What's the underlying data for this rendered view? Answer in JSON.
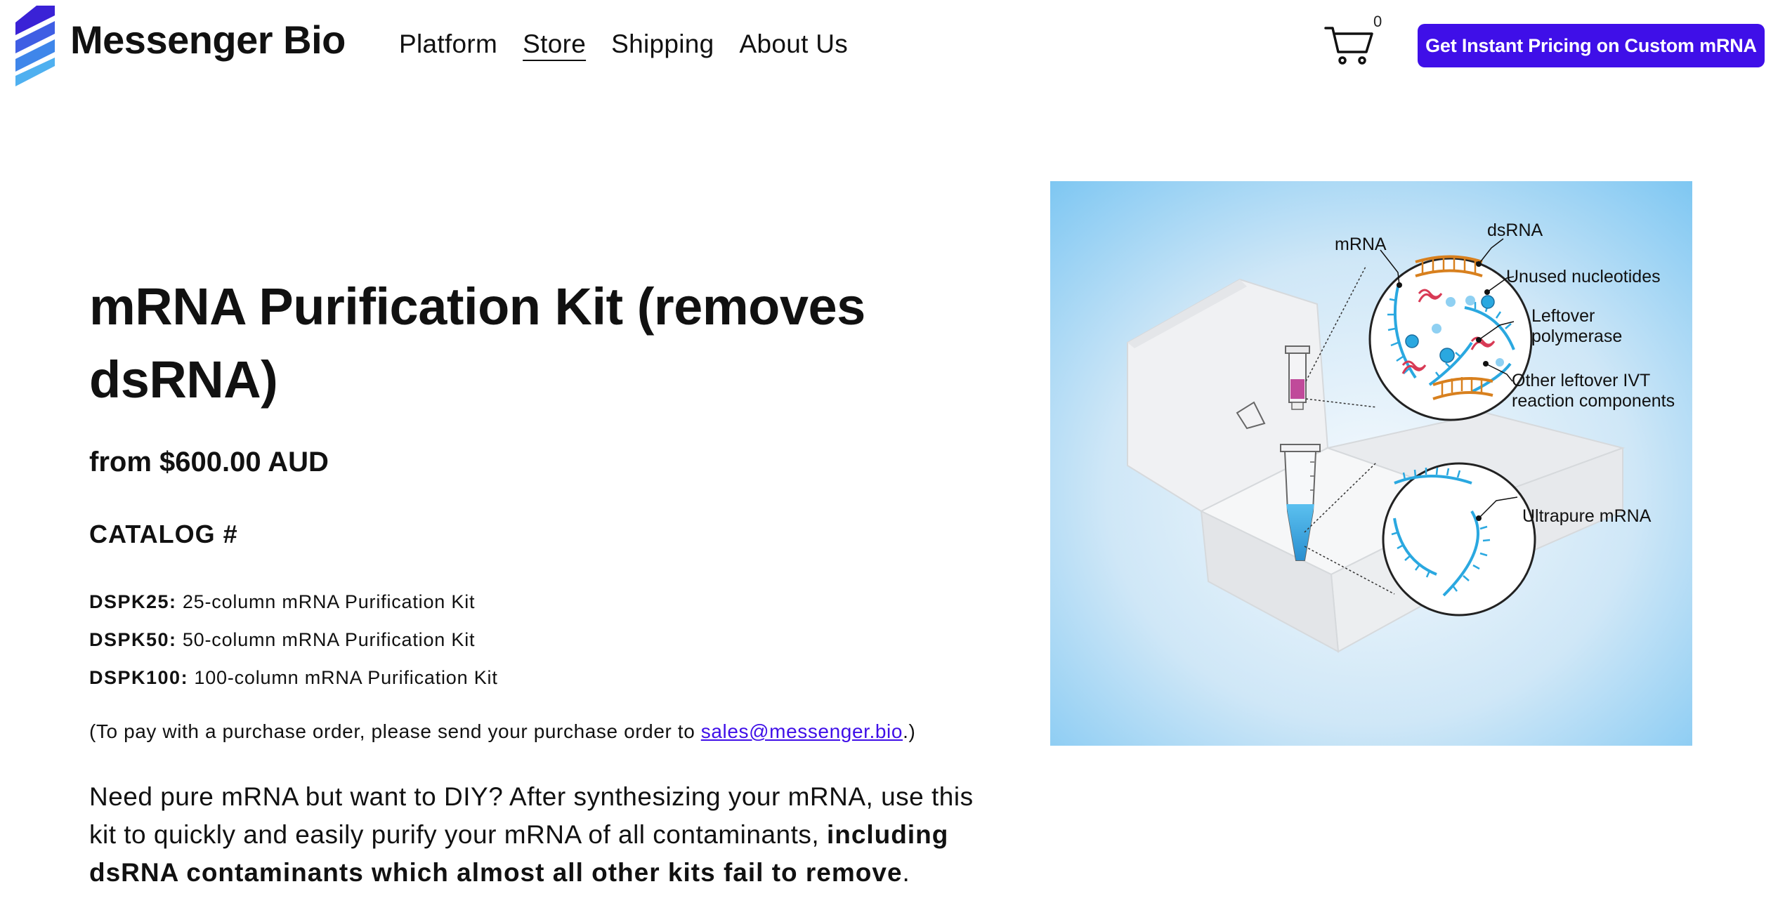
{
  "header": {
    "brand": "Messenger Bio",
    "nav": [
      {
        "label": "Platform",
        "active": false
      },
      {
        "label": "Store",
        "active": true
      },
      {
        "label": "Shipping",
        "active": false
      },
      {
        "label": "About Us",
        "active": false
      }
    ],
    "cart_count": "0",
    "cta_label": "Get Instant Pricing on Custom mRNA"
  },
  "product": {
    "title": "mRNA Purification Kit (removes dsRNA)",
    "price": "from $600.00 AUD",
    "catalog_heading": "CATALOG #",
    "catalog_items": [
      {
        "code": "DSPK25:",
        "desc": "25-column mRNA Purification Kit"
      },
      {
        "code": "DSPK50:",
        "desc": "50-column mRNA Purification Kit"
      },
      {
        "code": "DSPK100:",
        "desc": "100-column mRNA Purification Kit"
      }
    ],
    "po_note": {
      "before": "(To pay with a purchase order, please send your purchase order to ",
      "email": "sales@messenger.bio",
      "after": ".)"
    },
    "description": {
      "text": "Need pure mRNA but want to DIY? After synthesizing your mRNA, use this kit to quickly and easily purify your mRNA of all contaminants, ",
      "bold": "including dsRNA contaminants which almost all other kits fail to remove",
      "end": "."
    }
  },
  "image": {
    "labels": {
      "mrna": "mRNA",
      "dsrna": "dsRNA",
      "unused": "Unused nucleotides",
      "leftover_1": "Leftover",
      "leftover_2": "polymerase",
      "other_1": "Other leftover IVT",
      "other_2": "reaction components",
      "ultrapure": "Ultrapure mRNA"
    }
  },
  "colors": {
    "accent": "#3f0fe8",
    "logo_dark": "#4a2bd8",
    "logo_light": "#4fb0f0",
    "image_bg": "#7fc8f2",
    "rna_blue": "#2aa8e0",
    "dsrna_orange": "#d8801e",
    "polymerase_red": "#d83a55",
    "pink_sample": "#c04a9a"
  },
  "icons": {
    "logo": "stacked-chevron-logo-icon",
    "cart": "shopping-cart-icon"
  }
}
